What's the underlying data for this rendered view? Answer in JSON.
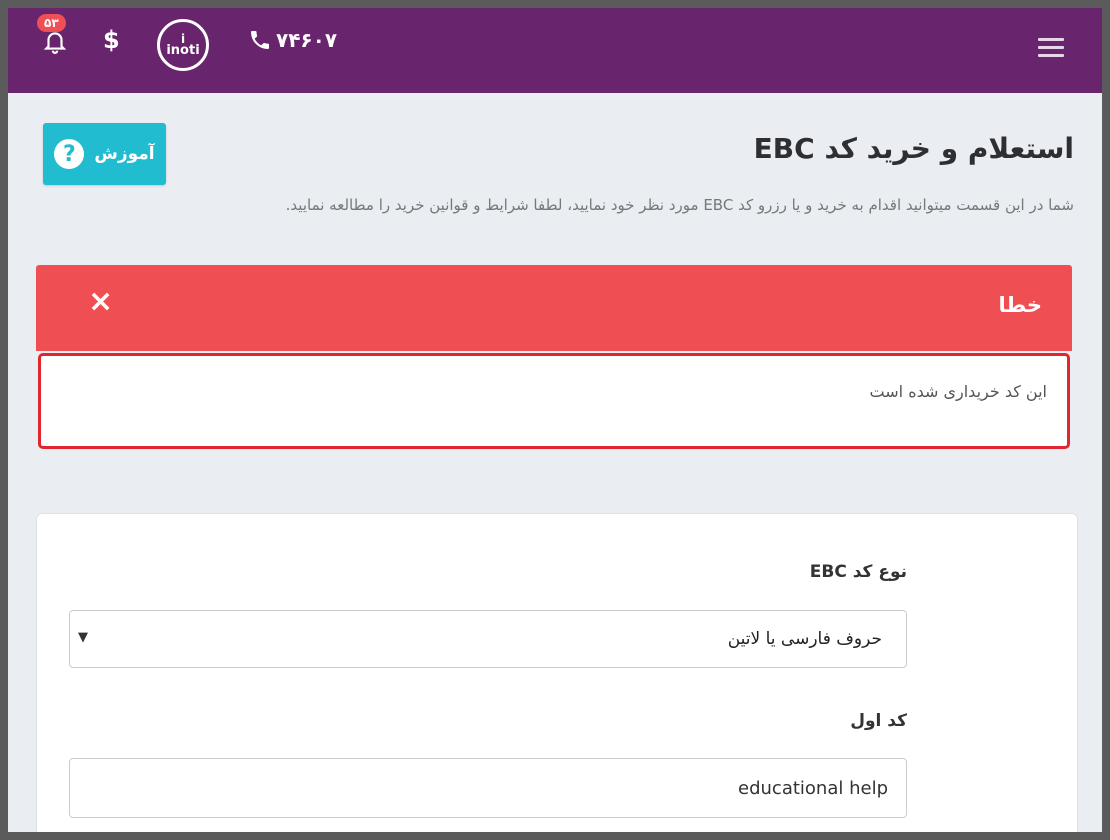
{
  "header": {
    "phone": "۷۴۶۰۷",
    "logo_text": "inoti",
    "logo_symbol": "i",
    "currency_icon": "$",
    "notification_count": "۵۳",
    "bg_color": "#68246c"
  },
  "page": {
    "title": "استعلام و خرید کد EBC",
    "subtitle": "شما در این قسمت میتوانید اقدام به خرید و یا رزرو کد EBC مورد نظر خود نمایید، لطفا شرایط و قوانین خرید را مطالعه نمایید.",
    "help_label": "آموزش",
    "help_icon": "?"
  },
  "alert": {
    "title": "خطا",
    "close_symbol": "×",
    "message": "این کد خریداری شده است",
    "color": "#ef4f52"
  },
  "form": {
    "type_label": "نوع کد EBC",
    "type_selected": "حروف فارسی یا لاتین",
    "type_arrow": "▼",
    "first_code_label": "کد اول",
    "first_code_value": "educational help"
  }
}
